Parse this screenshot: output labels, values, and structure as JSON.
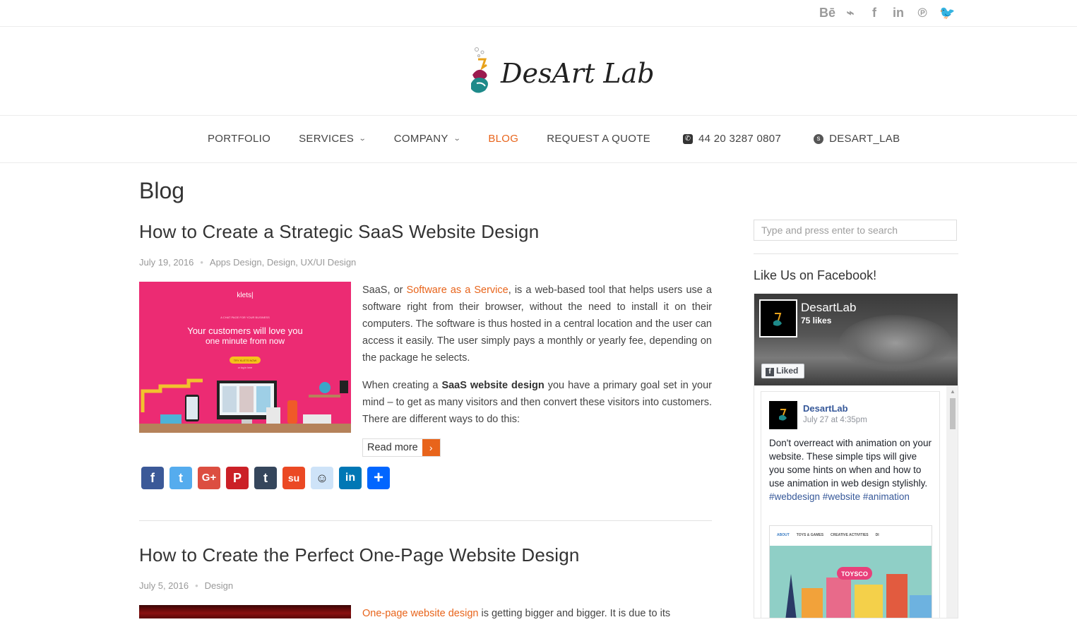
{
  "social_top": [
    {
      "name": "behance-icon",
      "glyph": "Bē"
    },
    {
      "name": "dribbble-icon",
      "glyph": "⌁"
    },
    {
      "name": "facebook-icon",
      "glyph": "f"
    },
    {
      "name": "linkedin-icon",
      "glyph": "in"
    },
    {
      "name": "pinterest-icon",
      "glyph": "℗"
    },
    {
      "name": "twitter-icon",
      "glyph": "🐦"
    }
  ],
  "logo": {
    "text": "DesArt Lab"
  },
  "nav": {
    "portfolio": "PORTFOLIO",
    "services": "SERVICES",
    "company": "COMPANY",
    "blog": "BLOG",
    "quote": "REQUEST A QUOTE",
    "phone": "44 20 3287 0807",
    "skype": "DESART_LAB",
    "active_color": "#e8641b"
  },
  "page": {
    "title": "Blog"
  },
  "posts": [
    {
      "title": "How to Create a Strategic SaaS Website Design",
      "date": "July 19, 2016",
      "categories": "Apps Design, Design, UX/UI Design",
      "p1_a": "SaaS, or ",
      "p1_link": "Software as a Service",
      "p1_b": ", is a web-based tool that helps users use a software right from their browser, without the need to install it on their computers. The software is thus hosted in a central location and the user can access it easily. The user simply pays a monthly or yearly fee, depending on the package he selects.",
      "p2_a": "When creating a ",
      "p2_bold": "SaaS website design",
      "p2_b": " you have a primary goal set in your mind – to get as many visitors and then convert these visitors into customers. There are different ways to do this:",
      "read_more": "Read more",
      "thumb": {
        "brand": "klets|",
        "kicker": "A CHAT PAGE FOR YOUR BUSINESS",
        "headline1": "Your customers will love you",
        "headline2": "one minute from now",
        "cta": "TRY KLETS NOW",
        "sub": "or log in here",
        "bg": "#ec2b73"
      }
    },
    {
      "title": "How to Create the Perfect One-Page Website Design",
      "date": "July 5, 2016",
      "categories": "Design",
      "p1_link": "One-page website design",
      "p1_b": " is getting bigger and bigger. It is due to its"
    }
  ],
  "share": [
    {
      "name": "share-facebook-icon",
      "glyph": "f",
      "color": "#3b5998"
    },
    {
      "name": "share-twitter-icon",
      "glyph": "t",
      "color": "#55acee"
    },
    {
      "name": "share-googleplus-icon",
      "glyph": "G+",
      "color": "#dc4e41"
    },
    {
      "name": "share-pinterest-icon",
      "glyph": "P",
      "color": "#cb2027"
    },
    {
      "name": "share-tumblr-icon",
      "glyph": "t",
      "color": "#35465c"
    },
    {
      "name": "share-stumbleupon-icon",
      "glyph": "su",
      "color": "#eb4924"
    },
    {
      "name": "share-reddit-icon",
      "glyph": "☺",
      "color": "#cee3f8"
    },
    {
      "name": "share-linkedin-icon",
      "glyph": "in",
      "color": "#0077b5"
    },
    {
      "name": "share-more-icon",
      "glyph": "+",
      "color": "#0166ff"
    }
  ],
  "sidebar": {
    "search_placeholder": "Type and press enter to search",
    "widget_title": "Like Us on Facebook!",
    "fb": {
      "page_name": "DesartLab",
      "likes": "75 likes",
      "liked": "Liked",
      "post_author": "DesartLab",
      "post_date": "July 27 at 4:35pm",
      "post_text": "Don't overreact with animation on your website. These simple tips will give you some hints on when and how to use animation in web design stylishly.",
      "post_tags": "#webdesign #website #animation",
      "img_nav": [
        "ABOUT",
        "TOYS & GAMES",
        "CREATIVE ACTIVITIES",
        "DI"
      ],
      "img_sign": "TOYSCO"
    }
  }
}
